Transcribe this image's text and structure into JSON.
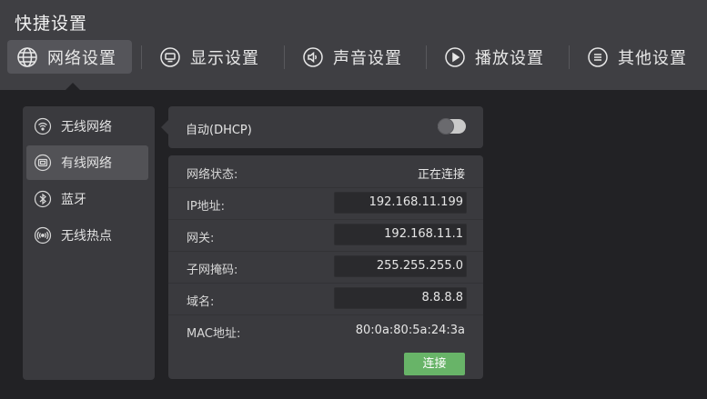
{
  "app": {
    "title": "快捷设置"
  },
  "tabs": [
    {
      "label": "网络设置",
      "icon": "globe-icon",
      "active": true
    },
    {
      "label": "显示设置",
      "icon": "monitor-icon",
      "active": false
    },
    {
      "label": "声音设置",
      "icon": "speaker-icon",
      "active": false
    },
    {
      "label": "播放设置",
      "icon": "play-icon",
      "active": false
    },
    {
      "label": "其他设置",
      "icon": "menu-icon",
      "active": false
    }
  ],
  "sidebar": {
    "items": [
      {
        "label": "无线网络",
        "icon": "wifi-icon",
        "active": false
      },
      {
        "label": "有线网络",
        "icon": "ethernet-icon",
        "active": true
      },
      {
        "label": "蓝牙",
        "icon": "bluetooth-icon",
        "active": false
      },
      {
        "label": "无线热点",
        "icon": "hotspot-icon",
        "active": false
      }
    ]
  },
  "dhcp": {
    "label": "自动(DHCP)",
    "enabled": false
  },
  "network": {
    "status": {
      "label": "网络状态:",
      "value": "正在连接"
    },
    "ip": {
      "label": "IP地址:",
      "value": "192.168.11.199"
    },
    "gateway": {
      "label": "网关:",
      "value": "192.168.11.1"
    },
    "subnet": {
      "label": "子网掩码:",
      "value": "255.255.255.0"
    },
    "dns": {
      "label": "域名:",
      "value": "8.8.8.8"
    },
    "mac": {
      "label": "MAC地址:",
      "value": "80:0a:80:5a:24:3a"
    }
  },
  "actions": {
    "connect_label": "连接"
  },
  "colors": {
    "accent_green": "#68b468",
    "panel": "#3a3a3e",
    "topbar": "#3f3f43"
  }
}
